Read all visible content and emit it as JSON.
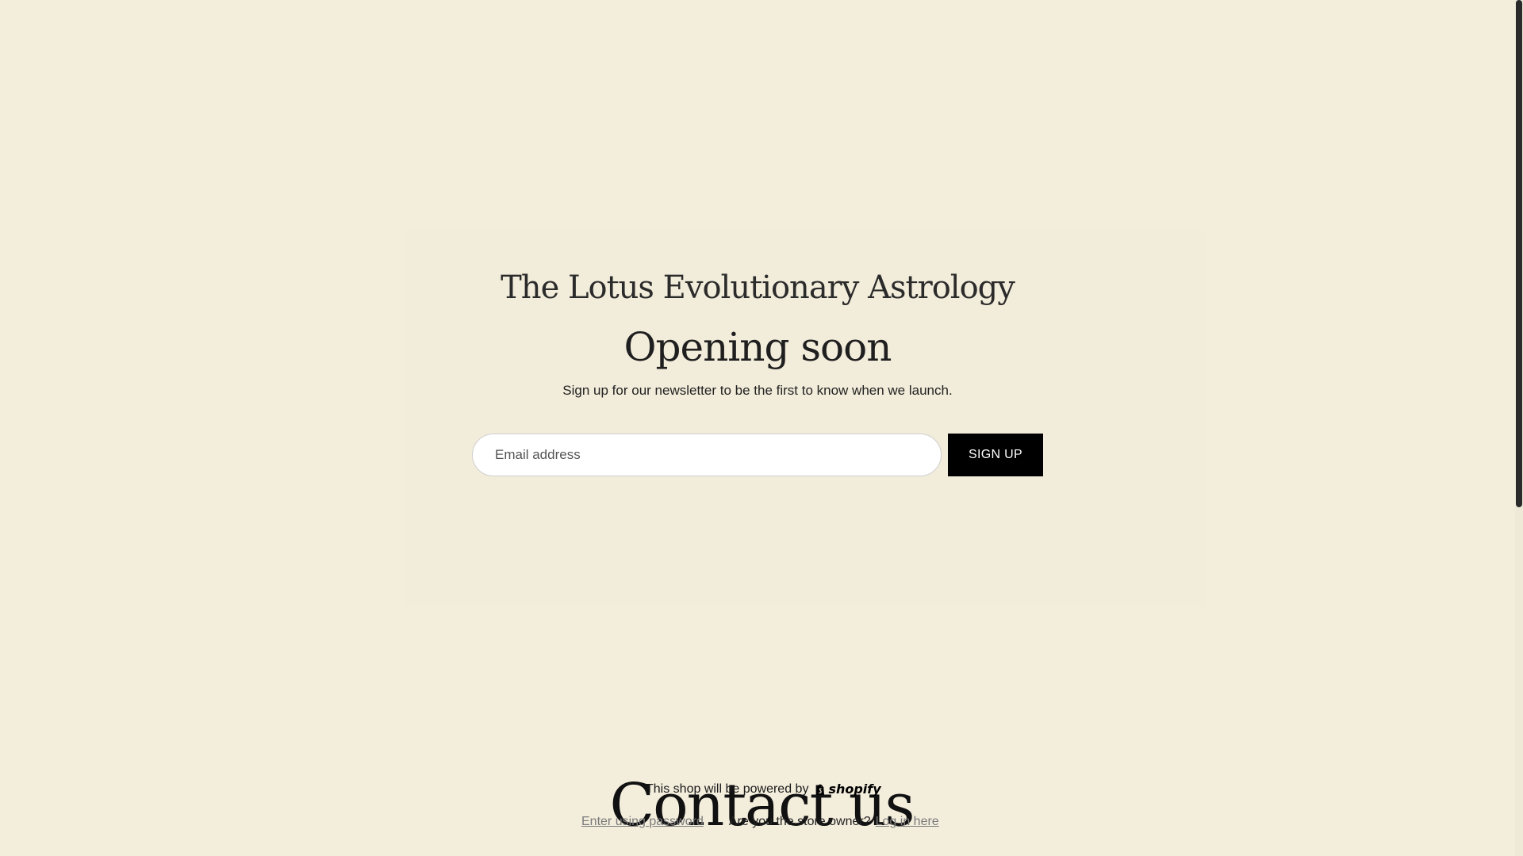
{
  "hero": {
    "store_name": "The Lotus Evolutionary Astrology",
    "headline": "Opening soon",
    "subtext": "Sign up for our newsletter to be the first to know when we launch."
  },
  "newsletter": {
    "email_placeholder": "Email address",
    "email_value": "",
    "signup_label": "SIGN UP"
  },
  "contact": {
    "heading": "Contact us"
  },
  "footer": {
    "powered_by": "This shop will be powered by",
    "shopify_label": "shopify",
    "enter_password": "Enter using password",
    "owner_question": "Are you the store owner?",
    "login_label": "Log in here"
  },
  "colors": {
    "background": "#f3eddc",
    "button": "#000000",
    "link": "#7a7a7a"
  }
}
